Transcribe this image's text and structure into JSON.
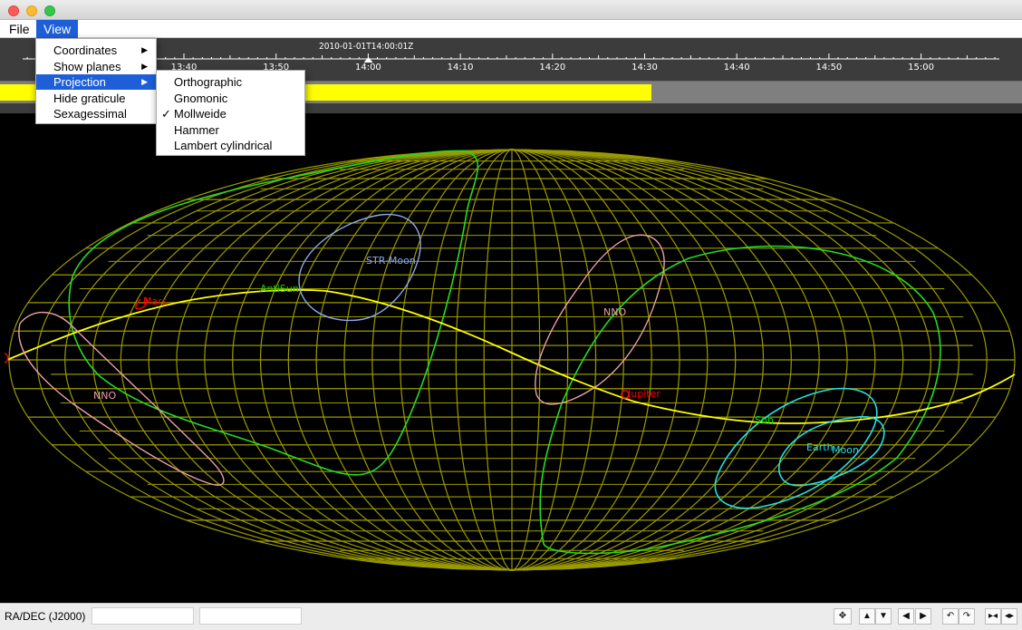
{
  "window": {
    "menubar": {
      "file": "File",
      "view": "View"
    }
  },
  "view_menu": {
    "items": [
      {
        "label": "Coordinates",
        "submenu": true,
        "selected": false
      },
      {
        "label": "Show planes",
        "submenu": true,
        "selected": false
      },
      {
        "label": "Projection",
        "submenu": true,
        "selected": true
      },
      {
        "label": "Hide graticule",
        "submenu": false,
        "selected": false
      },
      {
        "label": "Sexagessimal",
        "submenu": false,
        "selected": false
      }
    ],
    "arrow_glyph": "▶"
  },
  "projection_menu": {
    "items": [
      {
        "label": "Orthographic",
        "checked": false
      },
      {
        "label": "Gnomonic",
        "checked": false
      },
      {
        "label": "Mollweide",
        "checked": true
      },
      {
        "label": "Hammer",
        "checked": false
      },
      {
        "label": "Lambert cylindrical",
        "checked": false
      }
    ],
    "check_glyph": "✓"
  },
  "timeline": {
    "current_time": "2010-01-01T14:00:01Z",
    "tick_labels": [
      "13:40",
      "13:50",
      "14:00",
      "14:10",
      "14:20",
      "14:30",
      "14:40",
      "14:50",
      "15:00"
    ],
    "progress_fraction": 0.637
  },
  "sky_view": {
    "projection": "Mollweide",
    "colors": {
      "background": "#000000",
      "graticule": "#9a9a00",
      "ecliptic": "#ffff00",
      "planet": "#ff0000",
      "sun_antisun": "#00e000",
      "nno": "#e8a0a8",
      "str_moon": "#8fa8f0",
      "earth_moon": "#22e0e8",
      "green_curve": "#22dd22"
    },
    "labels": [
      {
        "id": "mars",
        "text": "Mars"
      },
      {
        "id": "antisun",
        "text": "AntiSun"
      },
      {
        "id": "str-moon",
        "text": "STR-Moon"
      },
      {
        "id": "nno-1",
        "text": "NNO"
      },
      {
        "id": "nno-2",
        "text": "NNO"
      },
      {
        "id": "jupiter",
        "text": "Jupiter"
      },
      {
        "id": "sun",
        "text": "Sun"
      },
      {
        "id": "earth",
        "text": "Earth"
      },
      {
        "id": "moon",
        "text": "Moon"
      }
    ]
  },
  "statusbar": {
    "coord_label": "RA/DEC (J2000)",
    "coord_value_1": "",
    "coord_value_2": "",
    "buttons": [
      {
        "id": "center",
        "glyph": "✥"
      },
      {
        "id": "up",
        "glyph": "▲"
      },
      {
        "id": "down",
        "glyph": "▼"
      },
      {
        "id": "left",
        "glyph": "◀"
      },
      {
        "id": "right",
        "glyph": "▶"
      },
      {
        "id": "rotate-ccw",
        "glyph": "↶"
      },
      {
        "id": "rotate-cw",
        "glyph": "↷"
      },
      {
        "id": "zoom-in",
        "glyph": "▸◂"
      },
      {
        "id": "zoom-out",
        "glyph": "◂▸"
      }
    ]
  }
}
